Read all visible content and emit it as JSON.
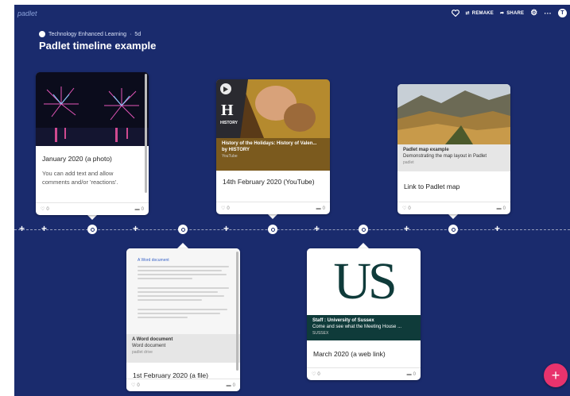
{
  "app": {
    "logo": "padlet"
  },
  "topbar": {
    "remake": "REMAKE",
    "share": "SHARE",
    "more": "···",
    "avatar": "T"
  },
  "breadcrumb": {
    "owner": "Technology Enhanced Learning",
    "sep": "·",
    "age": "5d"
  },
  "page_title": "Padlet timeline example",
  "cards": {
    "jan": {
      "title": "January 2020 (a photo)",
      "text": "You can add text and allow comments and/or 'reactions'.",
      "likes": "0",
      "comments": "0"
    },
    "feb14": {
      "caption_title": "History of the Holidays: History of Valen...",
      "caption_by": "by HISTORY",
      "caption_src": "YouTube",
      "title": "14th February 2020 (YouTube)",
      "likes": "0",
      "comments": "0",
      "thumb_text": "HISTORY"
    },
    "map": {
      "caption_title": "Padlet map example",
      "caption_desc": "Demonstrating the map layout in Padlet",
      "caption_src": "padlet",
      "title": "Link to Padlet map",
      "likes": "0",
      "comments": "0"
    },
    "feb1": {
      "doc_heading": "A Word document",
      "caption_title": "A Word document",
      "caption_type": "Word document",
      "caption_src": "padlet drive",
      "title": "1st February 2020 (a file)",
      "likes": "0",
      "comments": "0"
    },
    "mar": {
      "logo_text": "US",
      "caption_title": "Staff : University of Sussex",
      "caption_desc": "Come and see what the Meeting House ...",
      "caption_src": "SUSSEX",
      "title": "March 2020 (a web link)",
      "likes": "0",
      "comments": "0"
    }
  },
  "fab": "+",
  "colors": {
    "background": "#1a2b6d",
    "fab": "#e8336d",
    "history_band": "#7b5a1e",
    "sussex": "#0f3b3a"
  }
}
